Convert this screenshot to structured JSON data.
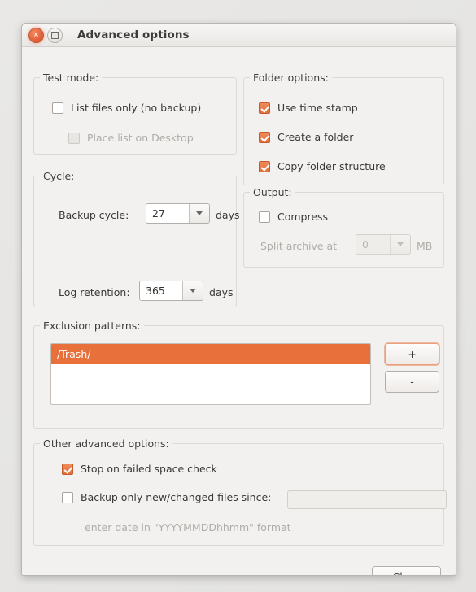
{
  "window": {
    "title": "Advanced options",
    "close_button": "close-window",
    "maximize_button": "maximize-window",
    "close_glyph": "×"
  },
  "test_mode": {
    "legend": "Test mode:",
    "list_files_only": {
      "label": "List files only (no backup)",
      "checked": false,
      "enabled": true
    },
    "place_list_on_desktop": {
      "label": "Place list on Desktop",
      "checked": false,
      "enabled": false
    }
  },
  "folder_options": {
    "legend": "Folder options:",
    "items": [
      {
        "label": "Use time stamp",
        "checked": true
      },
      {
        "label": "Create a folder",
        "checked": true
      },
      {
        "label": "Copy folder structure",
        "checked": true
      }
    ]
  },
  "cycle": {
    "legend": "Cycle:",
    "backup_cycle": {
      "label": "Backup cycle:",
      "value": "27",
      "unit": "days"
    },
    "log_retention": {
      "label": "Log retention:",
      "value": "365",
      "unit": "days"
    }
  },
  "output": {
    "legend": "Output:",
    "compress": {
      "label": "Compress",
      "checked": false
    },
    "split_archive": {
      "label": "Split archive at",
      "value": "0",
      "unit": "MB",
      "enabled": false
    }
  },
  "exclusion_patterns": {
    "legend": "Exclusion patterns:",
    "items": [
      {
        "text": "/Trash/",
        "selected": true
      }
    ],
    "add_button": "+",
    "remove_button": "-"
  },
  "other_advanced": {
    "legend": "Other advanced options:",
    "stop_on_failed_space_check": {
      "label": "Stop on failed space check",
      "checked": true
    },
    "backup_only_new": {
      "label": "Backup only new/changed files since:",
      "checked": false
    },
    "date_input": {
      "value": "",
      "placeholder": ""
    },
    "date_hint": "enter date in \"YYYYMMDDhhmm\" format"
  },
  "footer": {
    "close_label": "Close"
  },
  "colors": {
    "accent": "#e8703a",
    "window_bg": "#f2f1ef",
    "group_border": "#dcd8d4",
    "text": "#3a3937",
    "disabled_text": "#b0aca7"
  }
}
